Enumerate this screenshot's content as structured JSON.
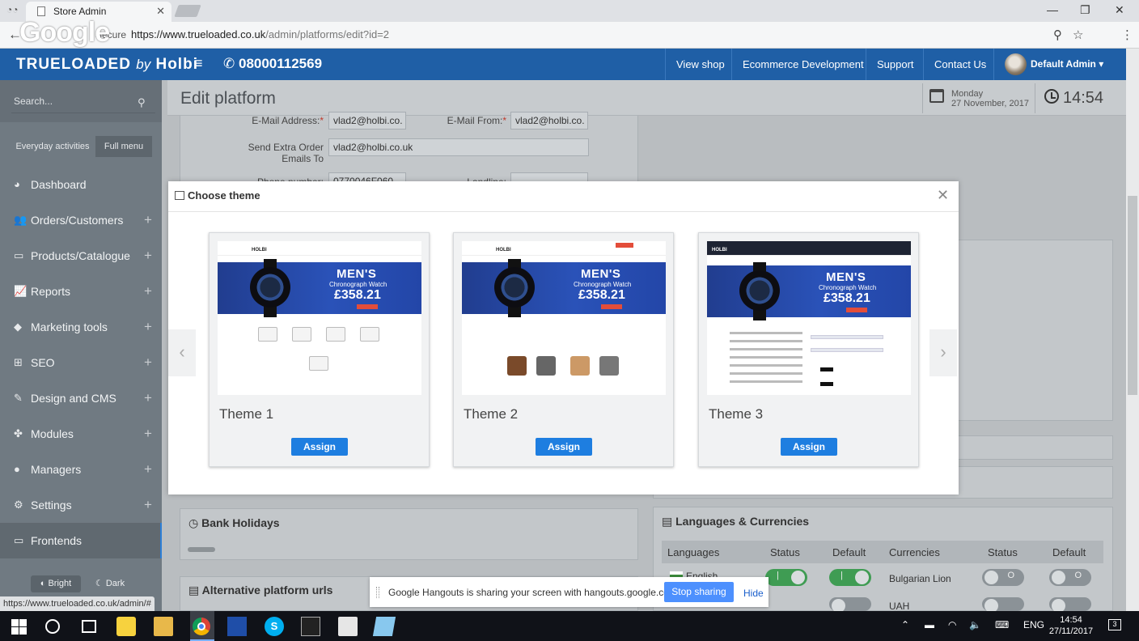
{
  "browser": {
    "tab_title": "Store Admin",
    "google_overlay": "Google",
    "secure_label": "Secure",
    "url_base": "https://www.trueloaded.co.uk",
    "url_path": "/admin/platforms/edit?id=2",
    "status_url": "https://www.trueloaded.co.uk/admin/#"
  },
  "header": {
    "logo_main": "TRUELOADED",
    "logo_by": "by",
    "logo_brand": "Holbi",
    "phone": "08000112569",
    "nav": [
      "View shop",
      "Ecommerce Development",
      "Support",
      "Contact Us"
    ],
    "user": "Default Admin"
  },
  "sidebar": {
    "search_placeholder": "Search...",
    "modes": [
      "Everyday activities",
      "Full menu"
    ],
    "items": [
      {
        "label": "Dashboard",
        "icon": "dashboard-icon",
        "plus": ""
      },
      {
        "label": "Orders/Customers",
        "icon": "users-icon",
        "plus": "+"
      },
      {
        "label": "Products/Catalogue",
        "icon": "folder-icon",
        "plus": "+"
      },
      {
        "label": "Reports",
        "icon": "line-chart-icon",
        "plus": "+"
      },
      {
        "label": "Marketing tools",
        "icon": "tag-icon",
        "plus": "+"
      },
      {
        "label": "SEO",
        "icon": "sitemap-icon",
        "plus": "+"
      },
      {
        "label": "Design and CMS",
        "icon": "brush-icon",
        "plus": "+"
      },
      {
        "label": "Modules",
        "icon": "puzzle-icon",
        "plus": "+"
      },
      {
        "label": "Managers",
        "icon": "user-icon",
        "plus": "+"
      },
      {
        "label": "Settings",
        "icon": "cogs-icon",
        "plus": "+"
      },
      {
        "label": "Frontends",
        "icon": "desktop-icon",
        "plus": ""
      }
    ],
    "theme_bright": "Bright",
    "theme_dark": "Dark"
  },
  "page": {
    "title": "Edit platform",
    "day": "Monday",
    "date": "27 November, 2017",
    "time": "14:54"
  },
  "form": {
    "email_label": "E-Mail Address:",
    "email_value": "vlad2@holbi.co.",
    "email_from_label": "E-Mail From:",
    "email_from_value": "vlad2@holbi.co.",
    "extra_label": "Send Extra Order Emails To",
    "extra_value": "vlad2@holbi.co.uk",
    "phone_label": "Phone number:",
    "phone_value": "0770046F060",
    "landline_label": "Landline:"
  },
  "sections": {
    "bank_holidays": "Bank Holidays",
    "alt_urls": "Alternative platform urls",
    "languages_currencies": "Languages & Currencies"
  },
  "lang_table": {
    "headers": [
      "Languages",
      "Status",
      "Default",
      "Currencies",
      "Status",
      "Default"
    ],
    "rows": [
      {
        "language": "English",
        "currency": "Bulgarian Lion"
      },
      {
        "language": "",
        "currency": "UAH"
      }
    ]
  },
  "modal": {
    "title": "Choose theme",
    "themes": [
      {
        "name": "Theme 1",
        "assign": "Assign",
        "banner_title": "MEN'S",
        "banner_sub": "Chronograph Watch",
        "price": "£358.21"
      },
      {
        "name": "Theme 2",
        "assign": "Assign",
        "banner_title": "MEN'S",
        "banner_sub": "Chronograph Watch",
        "price": "£358.21"
      },
      {
        "name": "Theme 3",
        "assign": "Assign",
        "banner_title": "MEN'S",
        "banner_sub": "Chronograph Watch",
        "price": "£358.21"
      }
    ],
    "preview_brand": "HOLBI"
  },
  "hangouts": {
    "message": "Google Hangouts is sharing your screen with hangouts.google.com.",
    "stop": "Stop sharing",
    "hide": "Hide"
  },
  "taskbar": {
    "lang": "ENG",
    "time": "14:54",
    "date": "27/11/2017"
  },
  "colors": {
    "header_blue": "#1f5fa6",
    "assign_blue": "#1e7ee0",
    "toggle_on": "#3f9c53"
  }
}
